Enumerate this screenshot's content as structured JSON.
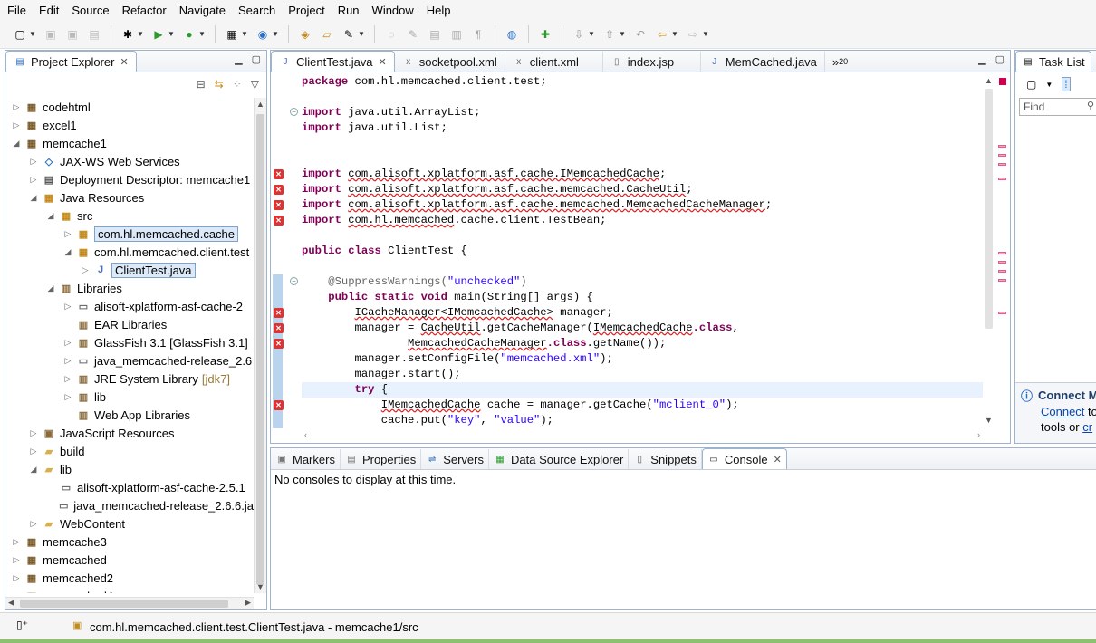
{
  "menu": [
    "File",
    "Edit",
    "Source",
    "Refactor",
    "Navigate",
    "Search",
    "Project",
    "Run",
    "Window",
    "Help"
  ],
  "explorer": {
    "title": "Project Explorer",
    "items": [
      {
        "label": "codehtml",
        "indent": 0,
        "toggle": "closed",
        "icon": "project-icon"
      },
      {
        "label": "excel1",
        "indent": 0,
        "toggle": "closed",
        "icon": "project-icon"
      },
      {
        "label": "memcache1",
        "indent": 0,
        "toggle": "open",
        "icon": "project-icon"
      },
      {
        "label": "JAX-WS Web Services",
        "indent": 1,
        "toggle": "closed",
        "icon": "web-services-icon"
      },
      {
        "label": "Deployment Descriptor: memcache1",
        "indent": 1,
        "toggle": "closed",
        "icon": "descriptor-icon"
      },
      {
        "label": "Java Resources",
        "indent": 1,
        "toggle": "open",
        "icon": "java-resources-icon"
      },
      {
        "label": "src",
        "indent": 2,
        "toggle": "open",
        "icon": "source-folder-icon"
      },
      {
        "label": "com.hl.memcached.cache",
        "indent": 3,
        "toggle": "closed",
        "icon": "package-icon",
        "selected": true
      },
      {
        "label": "com.hl.memcached.client.test",
        "indent": 3,
        "toggle": "open",
        "icon": "package-icon"
      },
      {
        "label": "ClientTest.java",
        "indent": 4,
        "toggle": "closed",
        "icon": "java-file-icon",
        "selected": true
      },
      {
        "label": "Libraries",
        "indent": 2,
        "toggle": "open",
        "icon": "libraries-icon"
      },
      {
        "label": "alisoft-xplatform-asf-cache-2",
        "indent": 3,
        "toggle": "closed",
        "icon": "jar-icon"
      },
      {
        "label": "EAR Libraries",
        "indent": 3,
        "toggle": "none",
        "icon": "library-icon"
      },
      {
        "label": "GlassFish 3.1 [GlassFish 3.1]",
        "indent": 3,
        "toggle": "closed",
        "icon": "library-icon"
      },
      {
        "label": "java_memcached-release_2.6",
        "indent": 3,
        "toggle": "closed",
        "icon": "jar-icon"
      },
      {
        "label": "JRE System Library",
        "suffix": "[jdk7]",
        "indent": 3,
        "toggle": "closed",
        "icon": "library-icon"
      },
      {
        "label": "lib",
        "indent": 3,
        "toggle": "closed",
        "icon": "library-icon"
      },
      {
        "label": "Web App Libraries",
        "indent": 3,
        "toggle": "none",
        "icon": "library-icon"
      },
      {
        "label": "JavaScript Resources",
        "indent": 1,
        "toggle": "closed",
        "icon": "js-resources-icon"
      },
      {
        "label": "build",
        "indent": 1,
        "toggle": "closed",
        "icon": "folder-icon"
      },
      {
        "label": "lib",
        "indent": 1,
        "toggle": "open",
        "icon": "folder-icon"
      },
      {
        "label": "alisoft-xplatform-asf-cache-2.5.1",
        "indent": 2,
        "toggle": "none",
        "icon": "jar-file-icon"
      },
      {
        "label": "java_memcached-release_2.6.6.ja",
        "indent": 2,
        "toggle": "none",
        "icon": "jar-file-icon"
      },
      {
        "label": "WebContent",
        "indent": 1,
        "toggle": "closed",
        "icon": "folder-icon"
      },
      {
        "label": "memcache3",
        "indent": 0,
        "toggle": "closed",
        "icon": "project-icon"
      },
      {
        "label": "memcached",
        "indent": 0,
        "toggle": "closed",
        "icon": "project-icon"
      },
      {
        "label": "memcached2",
        "indent": 0,
        "toggle": "closed",
        "icon": "project-icon"
      },
      {
        "label": "memcached4",
        "indent": 0,
        "toggle": "closed",
        "icon": "project-icon"
      }
    ]
  },
  "editor": {
    "tabs": [
      {
        "label": "ClientTest.java",
        "icon": "java-file-icon",
        "active": true,
        "close": "✕"
      },
      {
        "label": "socketpool.xml",
        "icon": "xml-file-icon"
      },
      {
        "label": "client.xml",
        "icon": "xml-file-icon"
      },
      {
        "label": "index.jsp",
        "icon": "jsp-file-icon"
      },
      {
        "label": "MemCached.java",
        "icon": "java-file-icon"
      }
    ],
    "overflow_label": "»",
    "overflow_count": "20",
    "lines": [
      [
        [
          "kw",
          "package"
        ],
        [
          "",
          "com.hl.memcached.client.test;"
        ]
      ],
      [],
      [
        [
          "kw",
          "import"
        ],
        [
          "",
          "java.util.ArrayList;"
        ]
      ],
      [
        [
          "kw",
          "import"
        ],
        [
          "",
          "java.util.List;"
        ]
      ],
      [],
      [],
      [
        [
          "kw",
          "import"
        ],
        [
          "err",
          "com.alisoft.xplatform.asf.cache.IMemcachedCache"
        ],
        [
          "",
          ";"
        ]
      ],
      [
        [
          "kw",
          "import"
        ],
        [
          "err",
          "com.alisoft.xplatform.asf.cache.memcached.CacheUtil"
        ],
        [
          "",
          ";"
        ]
      ],
      [
        [
          "kw",
          "import"
        ],
        [
          "err",
          "com.alisoft.xplatform.asf.cache.memcached.MemcachedCacheManager"
        ],
        [
          "",
          ";"
        ]
      ],
      [
        [
          "kw",
          "import"
        ],
        [
          "err",
          "com.hl.memcached"
        ],
        [
          "",
          ".cache.client.TestBean;"
        ]
      ],
      [],
      [
        [
          "kw",
          "public class"
        ],
        [
          "",
          "ClientTest {"
        ]
      ],
      [],
      [
        [
          "",
          "    "
        ],
        [
          "ann",
          "@SuppressWarnings("
        ],
        [
          "str",
          "\"unchecked\""
        ],
        [
          "ann",
          ")"
        ]
      ],
      [
        [
          "",
          "    "
        ],
        [
          "kw",
          "public static void"
        ],
        [
          "",
          "main(String[] args) {"
        ]
      ],
      [
        [
          "",
          "        "
        ],
        [
          "err",
          "ICacheManager<IMemcachedCache>"
        ],
        [
          "",
          "manager;"
        ]
      ],
      [
        [
          "",
          "        manager = "
        ],
        [
          "err",
          "CacheUtil"
        ],
        [
          "",
          ".getCacheManager("
        ],
        [
          "err",
          "IMemcachedCache"
        ],
        [
          "kw",
          ".class"
        ],
        [
          "",
          ","
        ]
      ],
      [
        [
          "",
          "                "
        ],
        [
          "err",
          "MemcachedCacheManager"
        ],
        [
          "kw",
          ".class"
        ],
        [
          "",
          ".getName());"
        ]
      ],
      [
        [
          "",
          "        manager.setConfigFile("
        ],
        [
          "str",
          "\"memcached.xml\""
        ],
        [
          "",
          ");"
        ]
      ],
      [
        [
          "",
          "        manager.start();"
        ]
      ],
      [
        [
          "",
          "        "
        ],
        [
          "kw",
          "try"
        ],
        [
          "",
          "{"
        ]
      ],
      [
        [
          "",
          "            "
        ],
        [
          "err",
          "IMemcachedCache"
        ],
        [
          "",
          "cache = manager.getCache("
        ],
        [
          "str",
          "\"mclient_0\""
        ],
        [
          "",
          ");"
        ]
      ],
      [
        [
          "",
          "            cache.put("
        ],
        [
          "str",
          "\"key\""
        ],
        [
          "",
          ", "
        ],
        [
          "str",
          "\"value\""
        ],
        [
          "",
          ");"
        ]
      ]
    ]
  },
  "task_list": {
    "title": "Task List",
    "find_placeholder": "Find",
    "connect_title": "Connect M",
    "connect_link": "Connect",
    "connect_text_1": "to",
    "connect_text_2": "tools or",
    "connect_link_2": "cr"
  },
  "console": {
    "tabs": [
      {
        "label": "Markers",
        "icon": "markers-icon"
      },
      {
        "label": "Properties",
        "icon": "properties-icon"
      },
      {
        "label": "Servers",
        "icon": "servers-icon"
      },
      {
        "label": "Data Source Explorer",
        "icon": "data-source-icon"
      },
      {
        "label": "Snippets",
        "icon": "snippets-icon"
      },
      {
        "label": "Console",
        "icon": "console-icon",
        "active": true,
        "close": "✕"
      }
    ],
    "message": "No consoles to display at this time."
  },
  "status": {
    "path": "com.hl.memcached.client.test.ClientTest.java - memcache1/src"
  }
}
